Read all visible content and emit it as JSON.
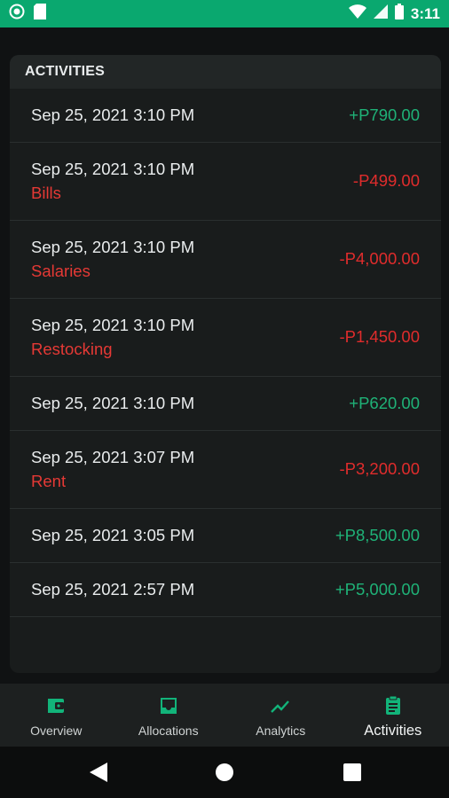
{
  "status_bar": {
    "time": "3:11"
  },
  "activities": {
    "header": "ACTIVITIES",
    "rows": [
      {
        "date": "Sep 25, 2021 3:10 PM",
        "category": "",
        "amount": "+P790.00",
        "sign": "pos"
      },
      {
        "date": "Sep 25, 2021 3:10 PM",
        "category": "Bills",
        "amount": "-P499.00",
        "sign": "neg"
      },
      {
        "date": "Sep 25, 2021 3:10 PM",
        "category": "Salaries",
        "amount": "-P4,000.00",
        "sign": "neg"
      },
      {
        "date": "Sep 25, 2021 3:10 PM",
        "category": "Restocking",
        "amount": "-P1,450.00",
        "sign": "neg"
      },
      {
        "date": "Sep 25, 2021 3:10 PM",
        "category": "",
        "amount": "+P620.00",
        "sign": "pos"
      },
      {
        "date": "Sep 25, 2021 3:07 PM",
        "category": "Rent",
        "amount": "-P3,200.00",
        "sign": "neg"
      },
      {
        "date": "Sep 25, 2021 3:05 PM",
        "category": "",
        "amount": "+P8,500.00",
        "sign": "pos"
      },
      {
        "date": "Sep 25, 2021 2:57 PM",
        "category": "",
        "amount": "+P5,000.00",
        "sign": "pos"
      }
    ]
  },
  "bottom_nav": {
    "items": [
      {
        "label": "Overview",
        "icon": "wallet-icon"
      },
      {
        "label": "Allocations",
        "icon": "inbox-icon"
      },
      {
        "label": "Analytics",
        "icon": "trending-up-icon"
      },
      {
        "label": "Activities",
        "icon": "clipboard-icon",
        "active": true
      }
    ]
  },
  "colors": {
    "accent": "#0aa86f",
    "positive": "#1fb277",
    "negative": "#e02c2c",
    "category": "#e53935"
  }
}
